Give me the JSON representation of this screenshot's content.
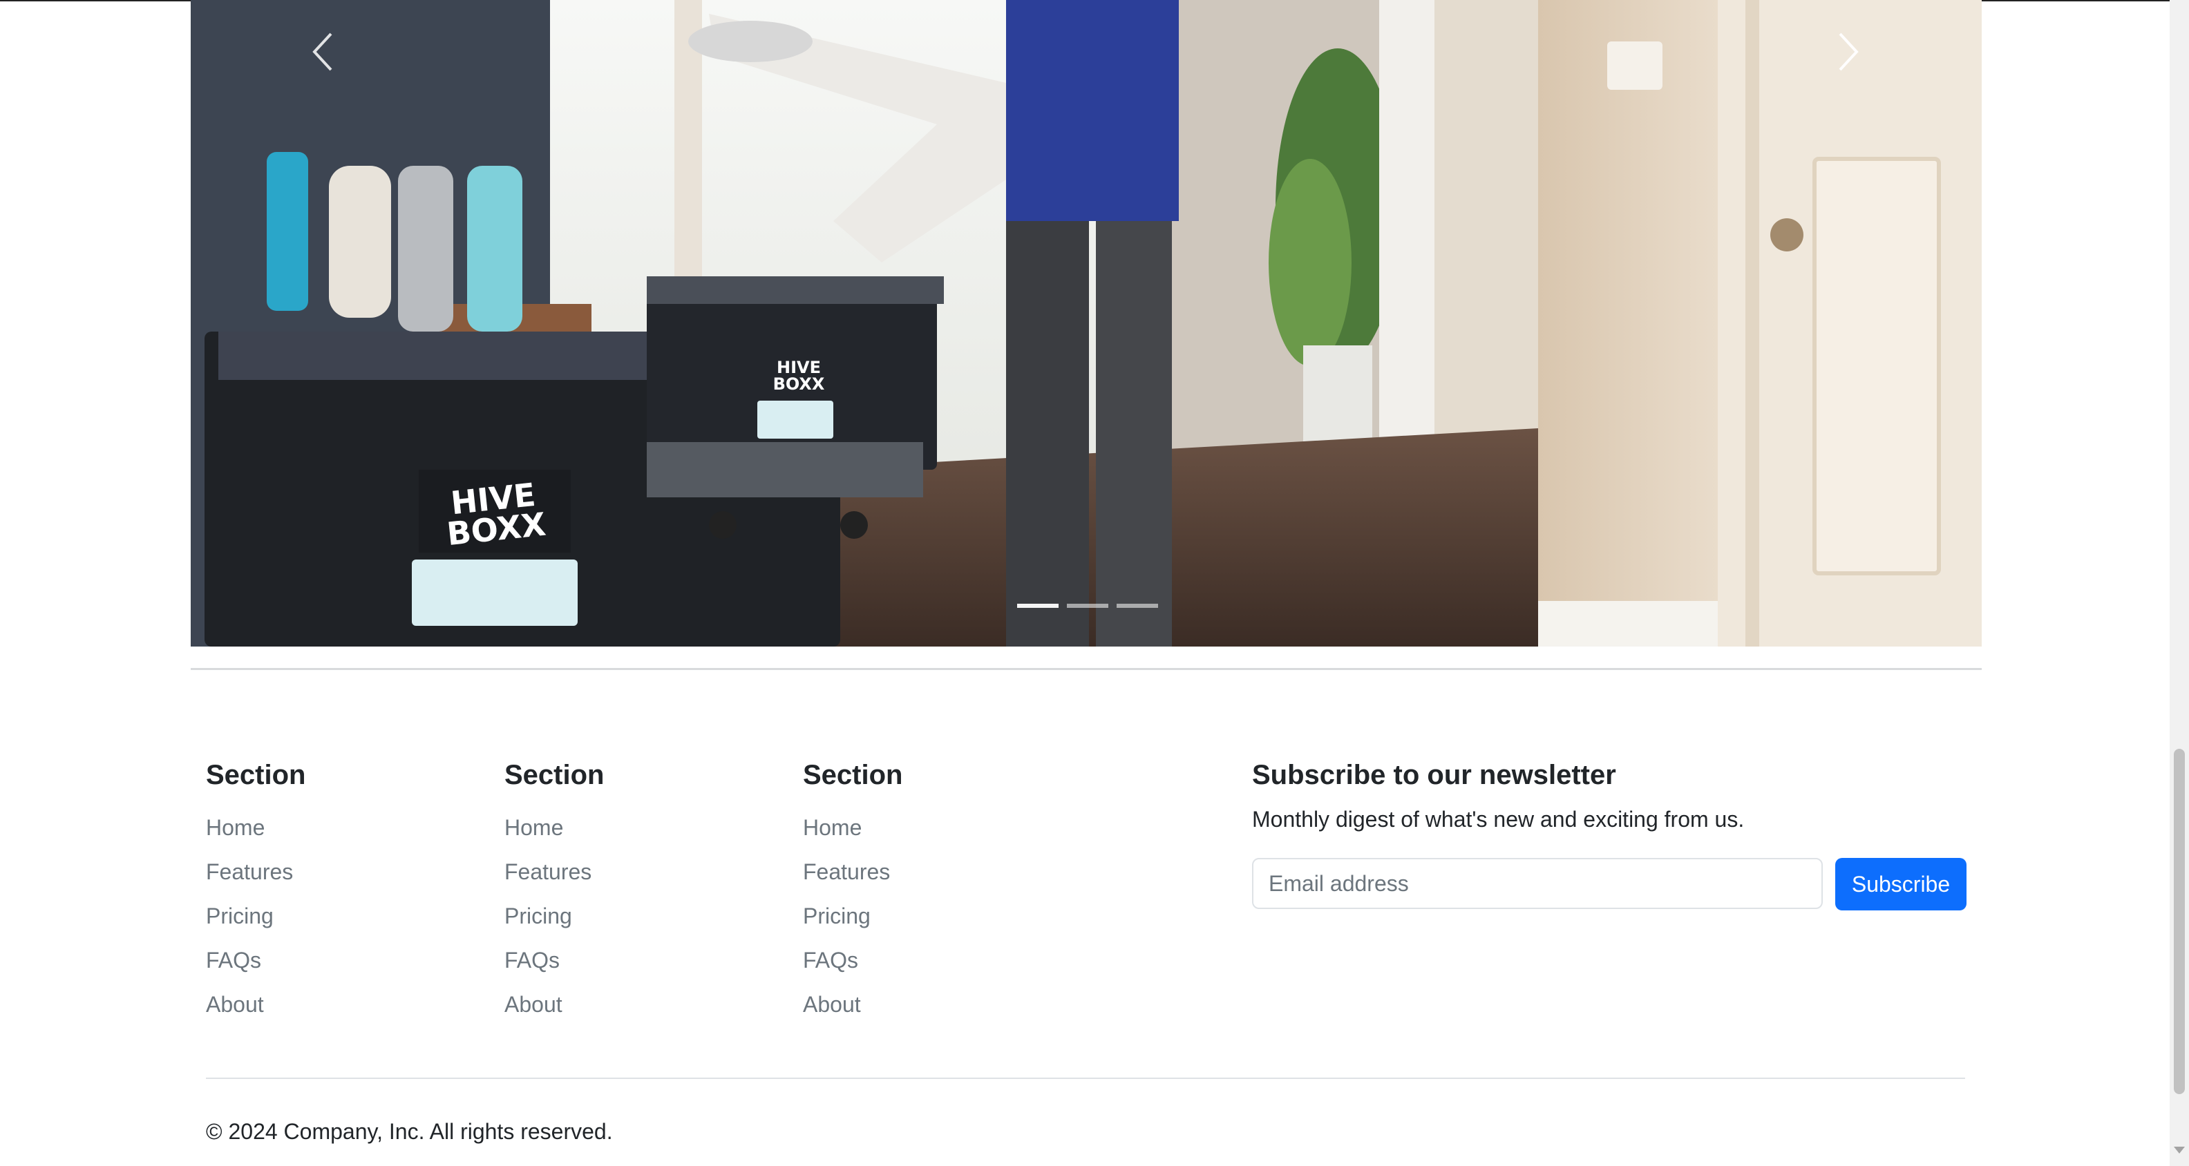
{
  "carousel": {
    "image_alt": "Moving boxes in an entryway",
    "box_logo_text": "HIVE BOXX",
    "prev_icon": "chevron-left-icon",
    "next_icon": "chevron-right-icon",
    "indicators_count": 3,
    "active_indicator": 1
  },
  "footer": {
    "sections": [
      {
        "heading": "Section",
        "links": [
          "Home",
          "Features",
          "Pricing",
          "FAQs",
          "About"
        ]
      },
      {
        "heading": "Section",
        "links": [
          "Home",
          "Features",
          "Pricing",
          "FAQs",
          "About"
        ]
      },
      {
        "heading": "Section",
        "links": [
          "Home",
          "Features",
          "Pricing",
          "FAQs",
          "About"
        ]
      }
    ],
    "newsletter": {
      "heading": "Subscribe to our newsletter",
      "description": "Monthly digest of what's new and exciting from us.",
      "email_placeholder": "Email address",
      "email_value": "",
      "button_label": "Subscribe"
    },
    "copyright": "© 2024 Company, Inc. All rights reserved."
  },
  "colors": {
    "primary": "#0d6efd",
    "muted_text": "#6c757d",
    "body_text": "#212529"
  }
}
